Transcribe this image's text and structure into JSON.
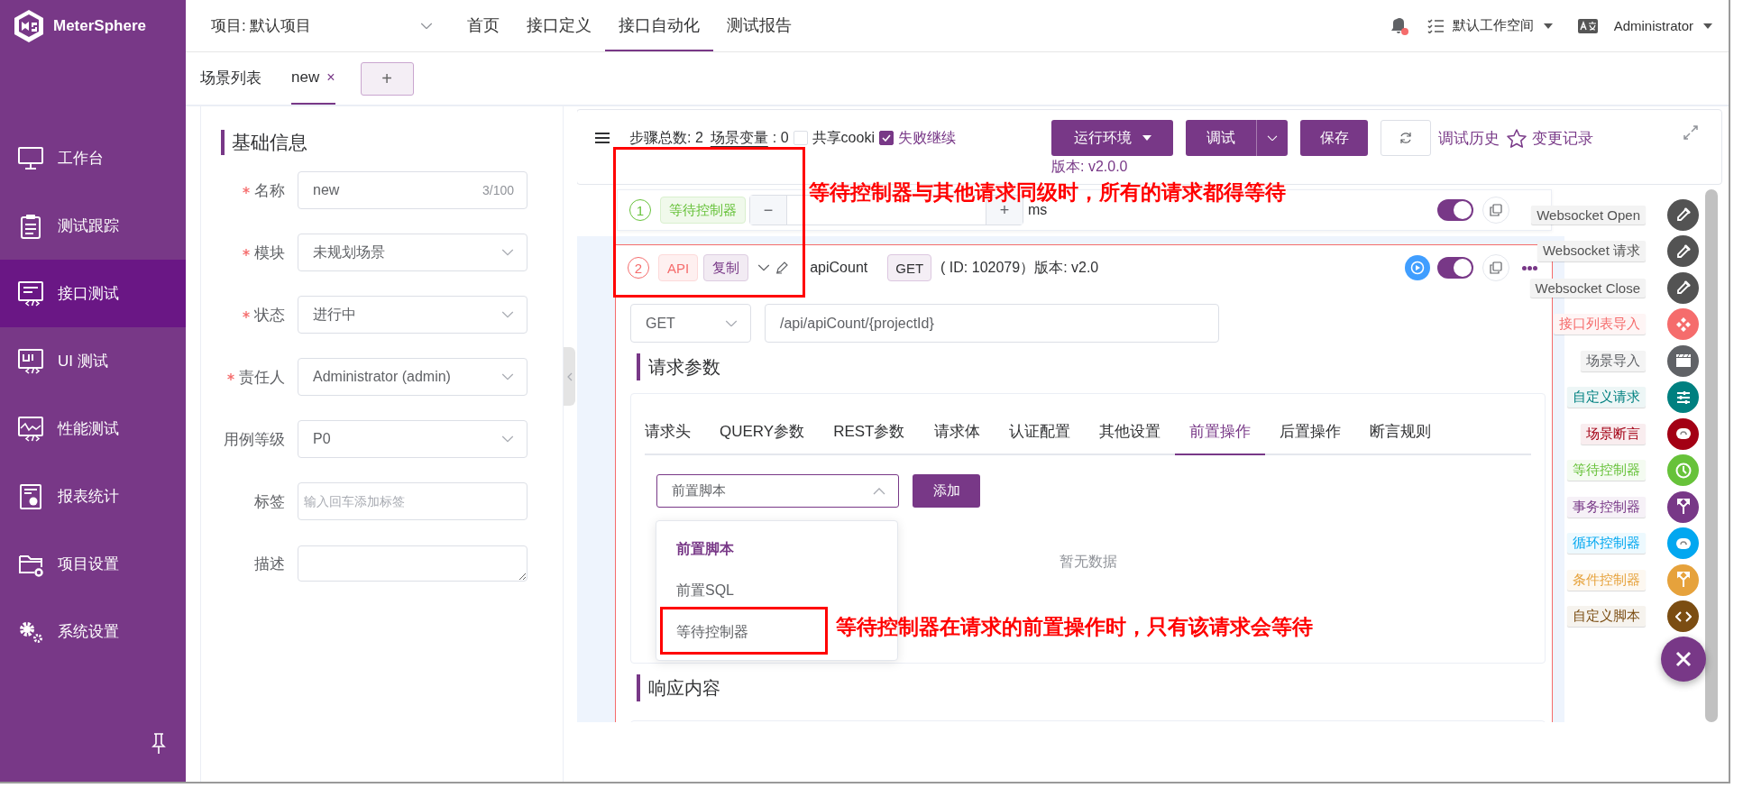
{
  "app": {
    "name": "MeterSphere"
  },
  "sidebar": {
    "items": [
      {
        "kind": "monitor",
        "label": "工作台",
        "selected": false
      },
      {
        "kind": "clipboard",
        "label": "测试跟踪",
        "selected": false
      },
      {
        "kind": "api",
        "label": "接口测试",
        "selected": true
      },
      {
        "kind": "ui",
        "label": "UI 测试",
        "selected": false
      },
      {
        "kind": "performance",
        "label": "性能测试",
        "selected": false
      },
      {
        "kind": "report",
        "label": "报表统计",
        "selected": false
      },
      {
        "kind": "folder",
        "label": "项目设置",
        "selected": false
      },
      {
        "kind": "gears",
        "label": "系统设置",
        "selected": false
      }
    ]
  },
  "header": {
    "project": "项目: 默认项目",
    "nav": [
      {
        "label": "首页",
        "selected": false
      },
      {
        "label": "接口定义",
        "selected": false
      },
      {
        "label": "接口自动化",
        "selected": true
      },
      {
        "label": "测试报告",
        "selected": false
      }
    ],
    "workspace": "默认工作空间",
    "user": "Administrator"
  },
  "tabs": [
    {
      "label": "场景列表",
      "selected": false
    },
    {
      "label": "new",
      "selected": true,
      "close": "×"
    }
  ],
  "add_tab": "+",
  "basic_info": {
    "title": "基础信息",
    "fields": [
      {
        "kind": "input",
        "label": "名称",
        "required": true,
        "value": "new",
        "counter": "3/100"
      },
      {
        "kind": "select",
        "label": "模块",
        "required": true,
        "value": "未规划场景"
      },
      {
        "kind": "select",
        "label": "状态",
        "required": true,
        "value": "进行中"
      },
      {
        "kind": "select",
        "label": "责任人",
        "required": true,
        "value": "Administrator (admin)"
      },
      {
        "kind": "select",
        "label": "用例等级",
        "required": false,
        "value": "P0"
      },
      {
        "kind": "tags",
        "label": "标签",
        "required": false,
        "placeholder": "输入回车添加标签"
      },
      {
        "kind": "textarea",
        "label": "描述",
        "required": false
      }
    ]
  },
  "toolbar": {
    "step_count": "步骤总数: 2",
    "variables": {
      "label": "场景变量",
      "value": ": 0"
    },
    "share_cookie": {
      "label": "共享cooki",
      "checked": false
    },
    "continue_on_fail": {
      "label": "失败继续",
      "checked": true
    },
    "environment": "运行环境",
    "debug": "调试",
    "save": "保存",
    "history": "调试历史",
    "changes": "变更记录",
    "version": "版本: v2.0.0"
  },
  "steps": [
    {
      "kind": "wait",
      "index": "1",
      "color": "#67c23a",
      "tags": [
        {
          "label": "等待控制器",
          "color": "#67c23a"
        }
      ],
      "minus": "−",
      "plus": "+",
      "unit": "ms",
      "enabled": true
    },
    {
      "kind": "api",
      "index": "2",
      "color": "#f56c6c",
      "tags": [
        {
          "label": "API",
          "color": "#f56c6c"
        },
        {
          "label": "复制",
          "color": "#783887"
        }
      ],
      "name": "apiCount",
      "method": "GET",
      "info": "( ID: 102079）版本: v2.0",
      "enabled": true
    }
  ],
  "request": {
    "method": "GET",
    "path": "/api/apiCount/{projectId}",
    "params_title": "请求参数",
    "tabs": [
      {
        "label": "请求头",
        "selected": false
      },
      {
        "label": "QUERY参数",
        "selected": false
      },
      {
        "label": "REST参数",
        "selected": false
      },
      {
        "label": "请求体",
        "selected": false
      },
      {
        "label": "认证配置",
        "selected": false
      },
      {
        "label": "其他设置",
        "selected": false
      },
      {
        "label": "前置操作",
        "selected": true
      },
      {
        "label": "后置操作",
        "selected": false
      },
      {
        "label": "断言规则",
        "selected": false
      }
    ],
    "processor_select": "前置脚本",
    "add": "添加",
    "empty": "暂无数据",
    "options": [
      {
        "label": "前置脚本",
        "selected": true
      },
      {
        "label": "前置SQL",
        "selected": false
      },
      {
        "label": "等待控制器",
        "selected": false
      }
    ],
    "response_title": "响应内容"
  },
  "fab": {
    "items": [
      {
        "kind": "pipette",
        "label": "Websocket Open",
        "color": "#535353"
      },
      {
        "kind": "pipette",
        "label": "Websocket 请求",
        "color": "#535353"
      },
      {
        "kind": "pipette",
        "label": "Websocket Close",
        "color": "#535353"
      },
      {
        "kind": "diamonds",
        "label": "接口列表导入",
        "color": "#f56c6c"
      },
      {
        "kind": "clapper",
        "label": "场景导入",
        "color": "#606266"
      },
      {
        "kind": "sliders",
        "label": "自定义请求",
        "color": "#008080"
      },
      {
        "kind": "gauge",
        "label": "场景断言",
        "color": "#a30014"
      },
      {
        "kind": "clock",
        "label": "等待控制器",
        "color": "#67c23a"
      },
      {
        "kind": "fork",
        "label": "事务控制器",
        "color": "#783887"
      },
      {
        "kind": "gauge",
        "label": "循环控制器",
        "color": "#02a7f0"
      },
      {
        "kind": "fork",
        "label": "条件控制器",
        "color": "#e6a23c"
      },
      {
        "kind": "code",
        "label": "自定义脚本",
        "color": "#7b4d12"
      }
    ]
  },
  "annotations": [
    {
      "text": "等待控制器与其他请求同级时，所有的请求都得等待"
    },
    {
      "text": "等待控制器在请求的前置操作时，只有该请求会等待"
    }
  ]
}
